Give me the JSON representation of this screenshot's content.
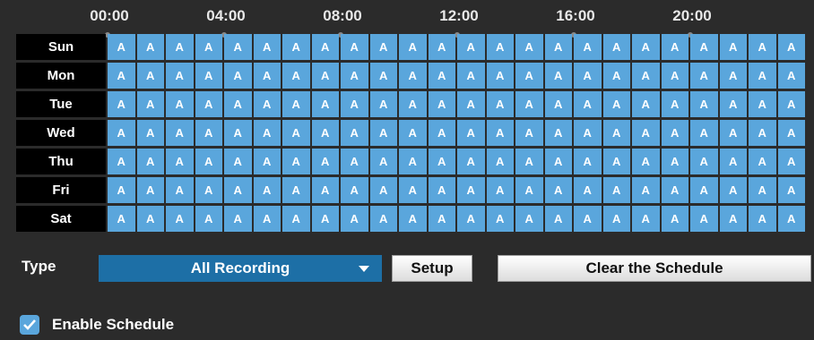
{
  "timeline": {
    "hours": [
      "00:00",
      "04:00",
      "08:00",
      "12:00",
      "16:00",
      "20:00"
    ]
  },
  "schedule": {
    "days": [
      "Sun",
      "Mon",
      "Tue",
      "Wed",
      "Thu",
      "Fri",
      "Sat"
    ],
    "slot_count": 24,
    "slot_value": "A"
  },
  "controls": {
    "type_label": "Type",
    "type_value": "All Recording",
    "setup_label": "Setup",
    "clear_label": "Clear the Schedule",
    "enable_label": "Enable Schedule",
    "enable_checked": true
  },
  "colors": {
    "background": "#2b2b2b",
    "cell": "#5aa6dc",
    "select": "#1d6fa6",
    "day_label_bg": "#000000"
  }
}
